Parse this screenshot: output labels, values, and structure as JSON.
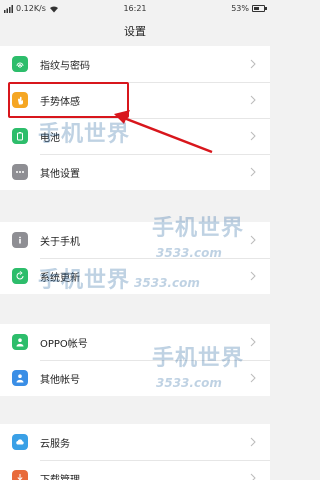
{
  "status_bar": {
    "signal_text": "0.12K/s",
    "time": "16:21",
    "battery_text": "53%",
    "battery_level": 0.53
  },
  "header": {
    "title": "设置"
  },
  "groups": [
    {
      "items": [
        {
          "label": "指纹与密码",
          "icon": "fingerprint-icon",
          "color": "#2dbd6b"
        },
        {
          "label": "手势体感",
          "icon": "hand-gesture-icon",
          "color": "#f5a623"
        },
        {
          "label": "电池",
          "icon": "battery-icon",
          "color": "#2dbd6b"
        },
        {
          "label": "其他设置",
          "icon": "more-dots-icon",
          "color": "#8e8e93"
        }
      ]
    },
    {
      "items": [
        {
          "label": "关于手机",
          "icon": "info-icon",
          "color": "#8e8e93"
        },
        {
          "label": "系统更新",
          "icon": "system-update-icon",
          "color": "#2dbd6b"
        }
      ]
    },
    {
      "items": [
        {
          "label": "OPPO帐号",
          "icon": "oppo-account-icon",
          "color": "#2dbd6b"
        },
        {
          "label": "其他帐号",
          "icon": "other-account-icon",
          "color": "#3a8ee6"
        }
      ]
    },
    {
      "items": [
        {
          "label": "云服务",
          "icon": "cloud-icon",
          "color": "#3aa0e6"
        },
        {
          "label": "下载管理",
          "icon": "download-icon",
          "color": "#e86a3a"
        }
      ]
    }
  ],
  "watermark": {
    "text": "手机世界",
    "number": "3533.com"
  },
  "colors": {
    "highlight": "#d8161c"
  }
}
